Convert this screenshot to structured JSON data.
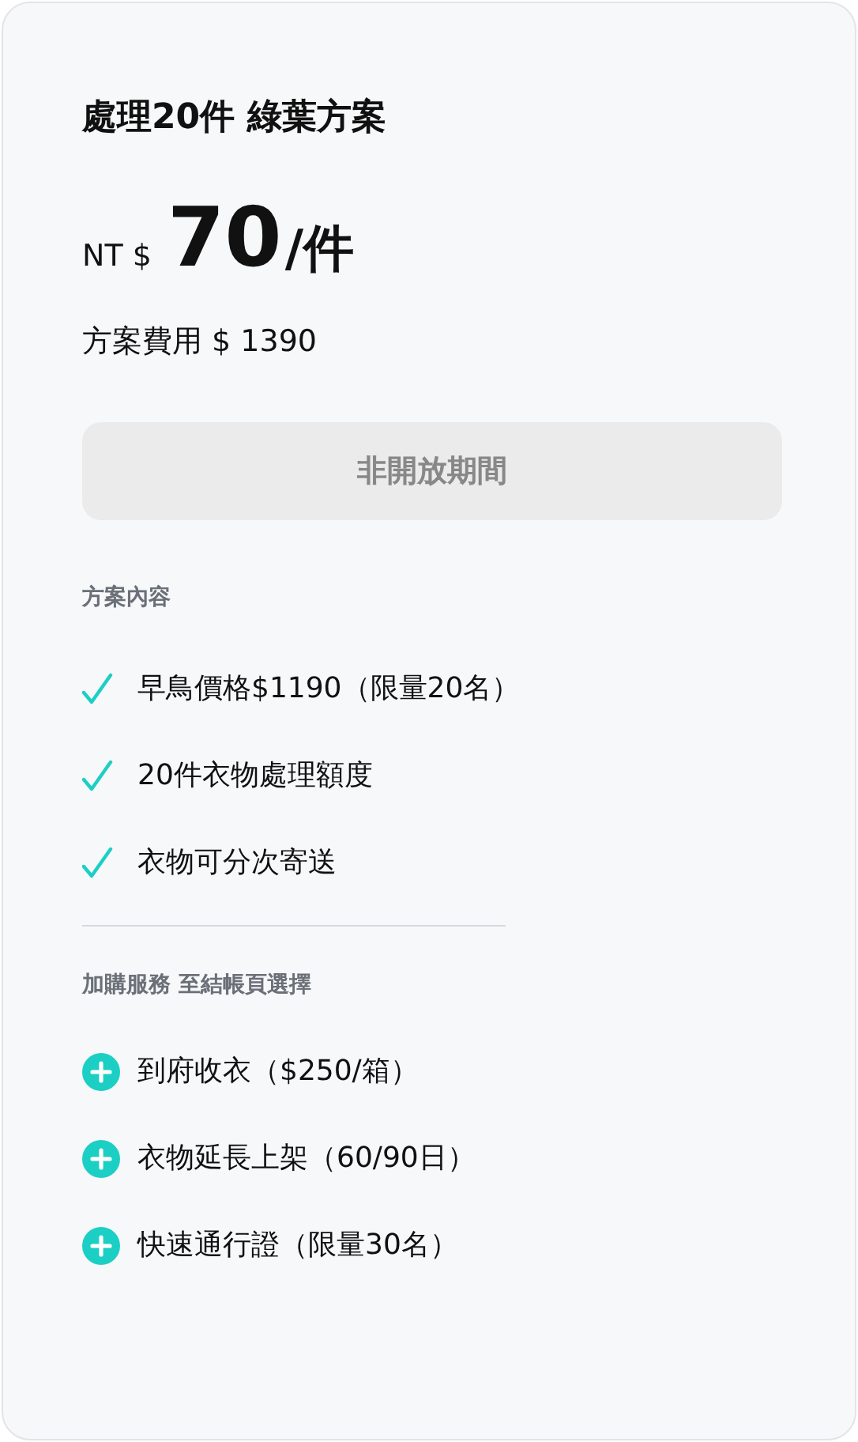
{
  "plan": {
    "title": "處理20件 綠葉方案",
    "currency": "NT $",
    "price": "70",
    "unit": "/件",
    "fee": "方案費用 $ 1390"
  },
  "action_button": {
    "label": "非開放期間",
    "disabled": true
  },
  "contents": {
    "heading": "方案內容",
    "items": [
      {
        "text": "早鳥價格$1190（限量20名）"
      },
      {
        "text": "20件衣物處理額度"
      },
      {
        "text": "衣物可分次寄送"
      }
    ]
  },
  "addons": {
    "heading": "加購服務 至結帳頁選擇",
    "items": [
      {
        "text": "到府收衣（$250/箱）"
      },
      {
        "text": "衣物延長上架（60/90日）"
      },
      {
        "text": "快速通行證（限量30名）"
      }
    ]
  }
}
